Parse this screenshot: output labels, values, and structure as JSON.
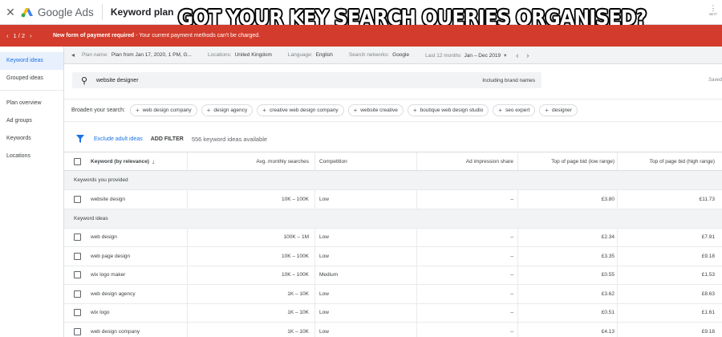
{
  "topbar": {
    "close_icon": "close-icon",
    "brand": "Google Ads",
    "page_title": "Keyword plan",
    "right_icon_label": "SETT"
  },
  "headline": "GOT YOUR KEY SEARCH QUERIES ORGANISED?",
  "alert": {
    "counter": "1 / 2",
    "message_bold": "New form of payment required",
    "message_rest": " - Your current payment methods can't be charged."
  },
  "nav": {
    "items": [
      {
        "label": "Keyword ideas",
        "active": true
      },
      {
        "label": "Grouped ideas",
        "active": false
      },
      {
        "label": "Plan overview",
        "active": false
      },
      {
        "label": "Ad groups",
        "active": false
      },
      {
        "label": "Keywords",
        "active": false
      },
      {
        "label": "Locations",
        "active": false
      }
    ]
  },
  "filters": {
    "plan_label": "Plan name:",
    "plan_value": "Plan from Jan 17, 2020, 1 PM, G...",
    "locations_label": "Locations:",
    "locations_value": "United Kingdom",
    "language_label": "Language:",
    "language_value": "English",
    "networks_label": "Search networks:",
    "networks_value": "Google",
    "period_label": "Last 12 months",
    "period_value": "Jan – Dec 2019"
  },
  "search": {
    "query": "website designer",
    "brand_toggle": "Including brand names",
    "saved": "Saved"
  },
  "broaden": {
    "label": "Broaden your search:",
    "chips": [
      "web design company",
      "design agency",
      "creative web design company",
      "website creative",
      "boutique web design studio",
      "seo expert",
      "designer"
    ]
  },
  "toolbar": {
    "exclude_adult": "Exclude adult ideas",
    "add_filter": "ADD FILTER",
    "count": "556 keyword ideas available"
  },
  "table": {
    "headers": {
      "keyword": "Keyword (by relevance)",
      "avg": "Avg. monthly searches",
      "competition": "Competition",
      "impression": "Ad impression share",
      "low": "Top of page bid (low range)",
      "high": "Top of page bid (high range)"
    },
    "group_provided": "Keywords you provided",
    "group_ideas": "Keyword ideas",
    "provided_rows": [
      {
        "keyword": "website design",
        "avg": "10K – 100K",
        "competition": "Low",
        "impression": "–",
        "low": "£3.80",
        "high": "£11.73"
      }
    ],
    "idea_rows": [
      {
        "keyword": "web design",
        "avg": "100K – 1M",
        "competition": "Low",
        "impression": "–",
        "low": "£2.34",
        "high": "£7.91"
      },
      {
        "keyword": "web page design",
        "avg": "10K – 100K",
        "competition": "Low",
        "impression": "–",
        "low": "£3.35",
        "high": "£9.18"
      },
      {
        "keyword": "wix logo maker",
        "avg": "10K – 100K",
        "competition": "Medium",
        "impression": "–",
        "low": "£0.55",
        "high": "£1.53"
      },
      {
        "keyword": "web design agency",
        "avg": "1K – 10K",
        "competition": "Low",
        "impression": "–",
        "low": "£3.62",
        "high": "£8.63"
      },
      {
        "keyword": "wix logo",
        "avg": "1K – 10K",
        "competition": "Low",
        "impression": "–",
        "low": "£0.51",
        "high": "£1.61"
      },
      {
        "keyword": "web design company",
        "avg": "1K – 10K",
        "competition": "Low",
        "impression": "–",
        "low": "£4.13",
        "high": "£9.18"
      }
    ]
  }
}
